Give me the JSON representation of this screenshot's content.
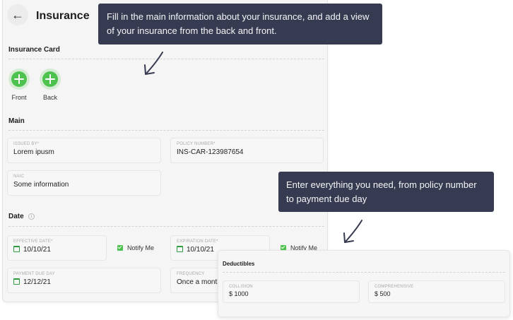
{
  "header": {
    "title": "Insurance",
    "back_icon": "arrow-left-icon"
  },
  "insurance_card": {
    "heading": "Insurance Card",
    "front_label": "Front",
    "back_label": "Back",
    "accent": "#4ec24e"
  },
  "main": {
    "heading": "Main",
    "issued_by": {
      "label": "ISSUED BY*",
      "value": "Lorem ipusm"
    },
    "policy_number": {
      "label": "POLICY NUMBER*",
      "value": "INS-CAR-123987654"
    },
    "naic": {
      "label": "NAIC",
      "value": "Some information"
    }
  },
  "date": {
    "heading": "Date",
    "effective": {
      "label": "EFFECTIVE DATE*",
      "value": "10/10/21",
      "notify_label": "Notify Me"
    },
    "expiration": {
      "label": "EXPIRATION DATE*",
      "value": "10/10/21",
      "notify_label": "Notify Me"
    },
    "payment_due": {
      "label": "PAYMENT DUE DAY",
      "value": "12/12/21"
    },
    "frequency": {
      "label": "FREQUENCY",
      "value": "Once a month"
    }
  },
  "deductibles": {
    "heading": "Deductibles",
    "collision": {
      "label": "COLLISION",
      "value": "$ 1000"
    },
    "comprehensive": {
      "label": "COMPREHENSIVE",
      "value": "$ 500"
    }
  },
  "tooltips": {
    "top": "Fill in the main information about your insurance, and add a view of your insurance from the back and front.",
    "right": "Enter everything you need, from policy number to payment due day"
  },
  "colors": {
    "tooltip_bg": "#363b51",
    "panel_bg": "#f5f5f5"
  }
}
